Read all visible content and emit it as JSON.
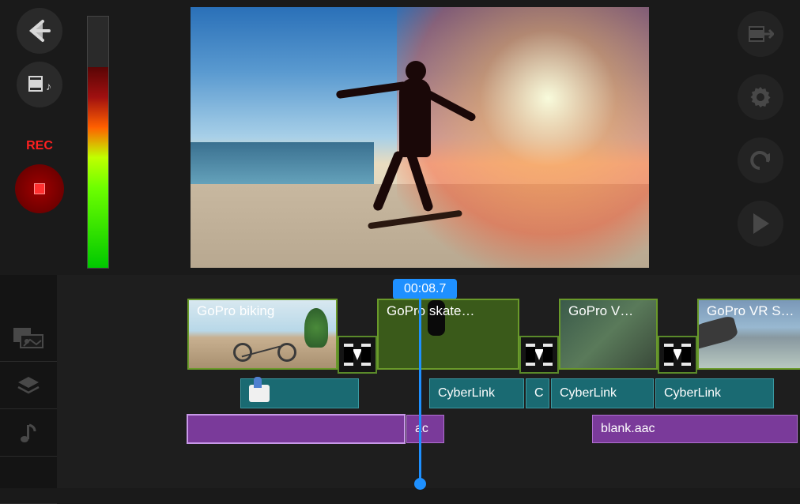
{
  "rec_label": "REC",
  "timecode": "00:08.7",
  "video_clips": [
    {
      "label": "GoPro biking"
    },
    {
      "label": "GoPro skate…"
    },
    {
      "label": "GoPro V…"
    },
    {
      "label": "GoPro VR  Skydiving with"
    }
  ],
  "sticker_clips": [
    {
      "label": ""
    },
    {
      "label": "CyberLink"
    },
    {
      "label": "C"
    },
    {
      "label": "CyberLink"
    },
    {
      "label": "CyberLink"
    }
  ],
  "audio_clips": [
    {
      "label": ""
    },
    {
      "label": "ac"
    },
    {
      "label": "blank.aac"
    }
  ],
  "icons": {
    "back": "back-arrow-icon",
    "media": "media-library-icon",
    "export": "export-icon",
    "settings": "gear-icon",
    "undo": "undo-icon",
    "play": "play-icon",
    "fx": "fx-tab-icon",
    "layers": "layers-tab-icon",
    "music": "music-tab-icon"
  },
  "colors": {
    "accent": "#1e90ff",
    "rec": "#ff2020",
    "clip_border": "#6a9a2a",
    "sticker": "#1a6a72",
    "audio": "#7a3a9a"
  },
  "meter": {
    "level_percent": 80
  }
}
